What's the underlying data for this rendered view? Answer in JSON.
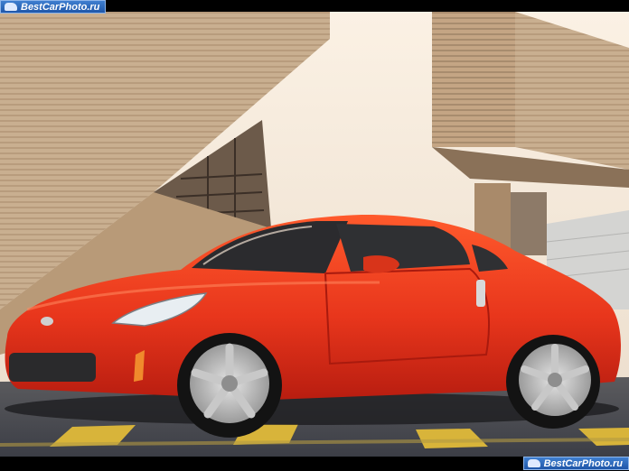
{
  "watermark_top": "BestCarPhoto.ru",
  "watermark_bottom": "BestCarPhoto.ru",
  "colors": {
    "sky": "#f2e4d2",
    "building": "#c7ad8f",
    "car_body": "#e8361c",
    "asphalt": "#4a4c52",
    "road_marking": "#d8b43a"
  },
  "icons": [
    "car-logo-icon"
  ]
}
